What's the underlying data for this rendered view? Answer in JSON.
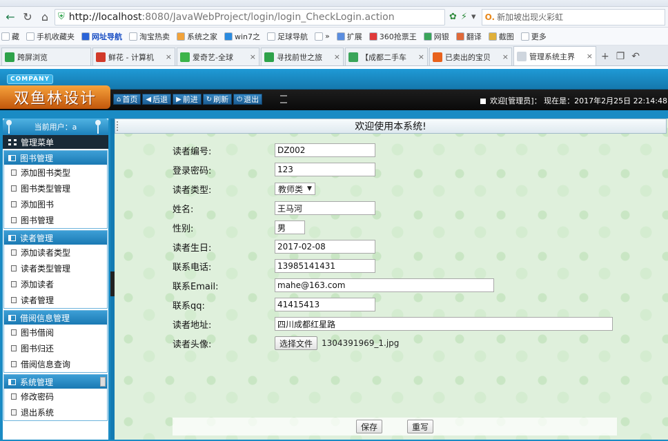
{
  "browser": {
    "url_host": "http://localhost",
    "url_rest": ":8080/JavaWebProject/login/login_CheckLogin.action",
    "search_placeholder": "新加坡出现火彩虹",
    "favorites": [
      {
        "label": "藏",
        "color": "#ffffff"
      },
      {
        "label": "手机收藏夹",
        "color": "#ffffff"
      },
      {
        "label": "网址导航",
        "color": "#2b64d8"
      },
      {
        "label": "淘宝热卖",
        "color": "#ffffff"
      },
      {
        "label": "系统之家",
        "color": "#f2a33a"
      },
      {
        "label": "win7之",
        "color": "#2a8be0"
      },
      {
        "label": "足球导航",
        "color": "#ffffff"
      },
      {
        "label": "»",
        "color": "#ffffff"
      },
      {
        "label": "扩展",
        "color": "#5a8de0"
      },
      {
        "label": "360抢票王",
        "color": "#e03a3a"
      },
      {
        "label": "网银",
        "color": "#3aa55a"
      },
      {
        "label": "翻译",
        "color": "#e06a3a"
      },
      {
        "label": "截图",
        "color": "#e0b03a"
      },
      {
        "label": "更多",
        "color": "#ffffff"
      }
    ],
    "tabs": [
      {
        "label": "跨屏浏览",
        "color": "#2ea24a",
        "active": false
      },
      {
        "label": "鲜花 - 计算机",
        "color": "#d13a2a",
        "active": false
      },
      {
        "label": "爱奇艺-全球",
        "color": "#3cb44a",
        "active": false
      },
      {
        "label": "寻找前世之旅",
        "color": "#2ea24a",
        "active": false
      },
      {
        "label": "【成都二手车",
        "color": "#3aa55a",
        "active": false
      },
      {
        "label": "已卖出的宝贝",
        "color": "#e8621d",
        "active": false
      },
      {
        "label": "管理系统主界",
        "color": "#cfd6de",
        "active": true
      }
    ]
  },
  "app": {
    "company": "COMPANY",
    "logo": "双鱼林设计",
    "toolbar": [
      {
        "icon": "home-icon",
        "glyph": "⌂",
        "label": "首页"
      },
      {
        "icon": "back-icon",
        "glyph": "◀",
        "label": "后退"
      },
      {
        "icon": "forward-icon",
        "glyph": "▶",
        "label": "前进"
      },
      {
        "icon": "refresh-icon",
        "glyph": "↻",
        "label": "刷新"
      },
      {
        "icon": "power-icon",
        "glyph": "⏻",
        "label": "退出"
      }
    ],
    "welcome": "欢迎[管理员]：  现在是：2017年2月25日  22:14:48"
  },
  "sidebar": {
    "current_user": "当前用户：a",
    "menu_title": "管理菜单",
    "groups": [
      {
        "title": "图书管理",
        "items": [
          "添加图书类型",
          "图书类型管理",
          "添加图书",
          "图书管理"
        ]
      },
      {
        "title": "读者管理",
        "items": [
          "添加读者类型",
          "读者类型管理",
          "添加读者",
          "读者管理"
        ]
      },
      {
        "title": "借阅信息管理",
        "items": [
          "图书借阅",
          "图书归还",
          "借阅信息查询"
        ]
      },
      {
        "title": "系统管理",
        "items": [
          "修改密码",
          "退出系统"
        ]
      }
    ]
  },
  "content": {
    "title": "欢迎使用本系统!",
    "form": {
      "reader_no": {
        "label": "读者编号:",
        "value": "DZ002"
      },
      "password": {
        "label": "登录密码:",
        "value": "123"
      },
      "reader_type": {
        "label": "读者类型:",
        "value": "教师类"
      },
      "name": {
        "label": "姓名:",
        "value": "王马河"
      },
      "gender": {
        "label": "性别:",
        "value": "男"
      },
      "birthday": {
        "label": "读者生日:",
        "value": "2017-02-08"
      },
      "phone": {
        "label": "联系电话:",
        "value": "13985141431"
      },
      "email": {
        "label": "联系Email:",
        "value": "mahe@163.com"
      },
      "qq": {
        "label": "联系qq:",
        "value": "41415413"
      },
      "address": {
        "label": "读者地址:",
        "value": "四川成都红星路"
      },
      "avatar": {
        "label": "读者头像:",
        "button": "选择文件",
        "filename": "1304391969_1.jpg"
      }
    },
    "save_label": "保存",
    "reset_label": "重写"
  }
}
